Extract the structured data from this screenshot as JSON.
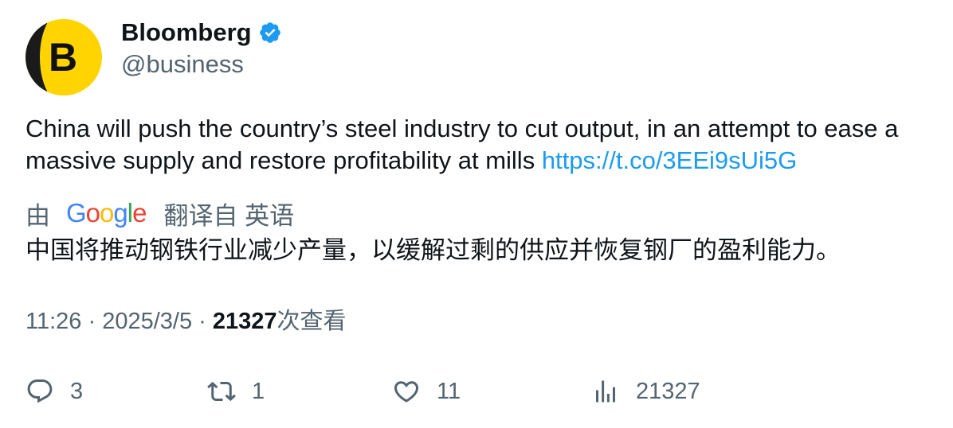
{
  "author": {
    "name": "Bloomberg",
    "handle": "@business",
    "avatar_letter": "B",
    "verified": true
  },
  "tweet": {
    "text": "China will push the country’s steel industry to cut output, in an attempt to ease a massive supply and restore profitability at mills ",
    "link": "https://t.co/3EEi9sUi5G"
  },
  "translation": {
    "prefix": "由",
    "provider_letters": [
      "G",
      "o",
      "o",
      "g",
      "l",
      "e"
    ],
    "suffix": "翻译自 英语",
    "text": "中国将推动钢铁行业减少产量，以缓解过剩的供应并恢复钢厂的盈利能力。"
  },
  "meta": {
    "time": "11:26",
    "separator": " · ",
    "date": "2025/3/5",
    "views_count": "21327",
    "views_label": "次查看"
  },
  "actions": {
    "replies": "3",
    "retweets": "1",
    "likes": "11",
    "views": "21327"
  },
  "colors": {
    "accent": "#1d9bf0",
    "avatar_bg": "#ffd700",
    "text_secondary": "#536471"
  }
}
